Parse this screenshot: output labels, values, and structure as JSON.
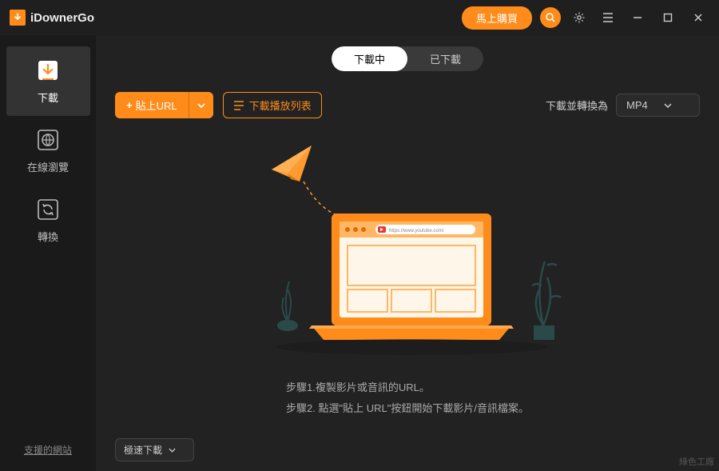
{
  "app": {
    "name": "iDownerGo"
  },
  "titlebar": {
    "buy": "馬上購買"
  },
  "sidebar": {
    "items": [
      {
        "label": "下載"
      },
      {
        "label": "在線瀏覽"
      },
      {
        "label": "轉換"
      }
    ],
    "support": "支援的網站"
  },
  "tabs": {
    "downloading": "下載中",
    "downloaded": "已下載"
  },
  "toolbar": {
    "paste": "貼上URL",
    "playlist": "下載播放列表",
    "formatLabel": "下載並轉換為",
    "formatValue": "MP4"
  },
  "hero": {
    "step1": "步驟1.複製影片或音訊的URL。",
    "step2": "步驟2. 點選\"貼上 URL\"按鈕開始下載影片/音訊檔案。",
    "browserUrl": "https://www.youtube.com/"
  },
  "bottom": {
    "speed": "極速下載"
  },
  "watermark": "綠色工廠"
}
